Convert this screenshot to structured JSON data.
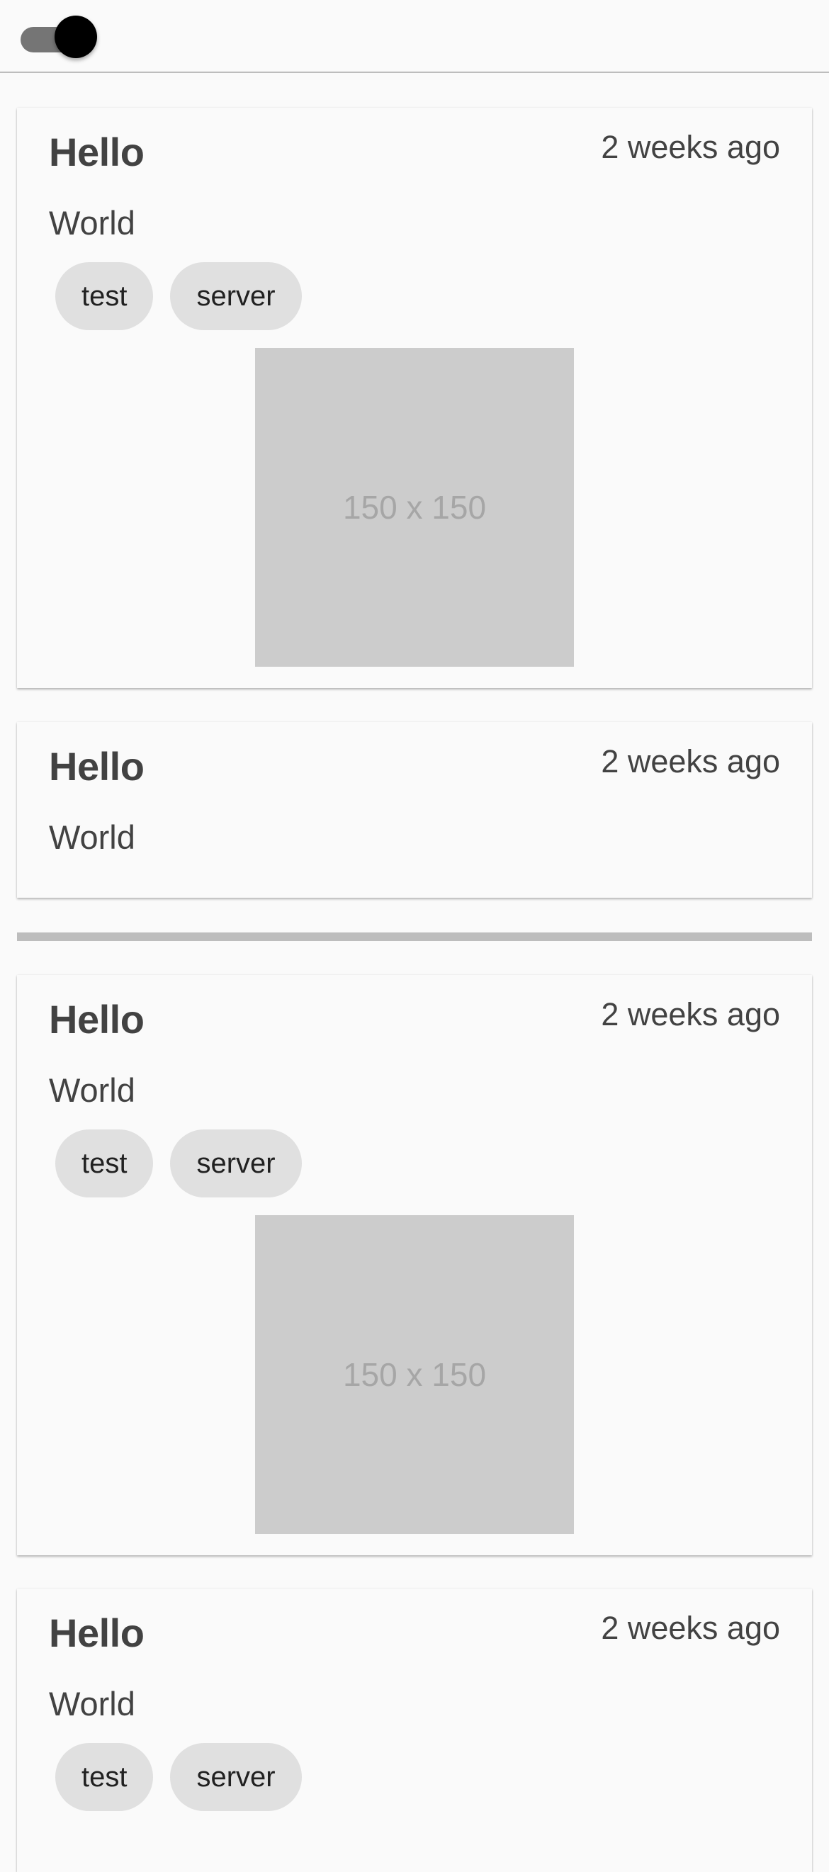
{
  "toggle": {
    "state": "on"
  },
  "cards": [
    {
      "title": "Hello",
      "time": "2 weeks ago",
      "body": "World",
      "chips": [
        "test",
        "server"
      ],
      "image_label": "150 x 150"
    },
    {
      "title": "Hello",
      "time": "2 weeks ago",
      "body": "World"
    },
    {
      "title": "Hello",
      "time": "2 weeks ago",
      "body": "World",
      "chips": [
        "test",
        "server"
      ],
      "image_label": "150 x 150"
    },
    {
      "title": "Hello",
      "time": "2 weeks ago",
      "body": "World",
      "chips": [
        "test",
        "server"
      ]
    }
  ],
  "colors": {
    "background": "#fafafa",
    "text": "#424242",
    "chip": "#e0e0e0",
    "placeholder": "#cccccc",
    "divider": "#bdbdbd",
    "toggle_thumb": "#000000",
    "toggle_track": "#757575"
  }
}
